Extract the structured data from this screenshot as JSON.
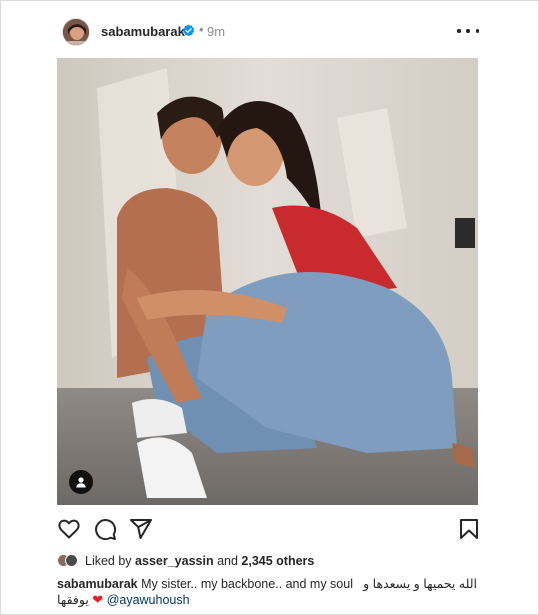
{
  "post": {
    "username": "sabamubarak",
    "time_separator": "•",
    "time": "9m",
    "liked_by_prefix": "Liked by",
    "liked_by_user": "asser_yassin",
    "liked_by_middle": "and",
    "liked_by_others": "2,345 others",
    "caption_user": "sabamubarak",
    "caption_text": "My sister.. my backbone.. and my soul",
    "caption_arabic_1": "الله يحميها و يسعدها و",
    "caption_arabic_2": "يوفقها",
    "caption_heart": "❤",
    "caption_mention": "@ayawuhoush"
  },
  "icons": {
    "avatar": "profile-avatar",
    "verified": "verified-badge-icon",
    "more": "more-options-icon",
    "tag": "user-tag-icon",
    "like": "heart-icon",
    "comment": "comment-icon",
    "share": "share-icon",
    "save": "bookmark-icon"
  },
  "colors": {
    "verified": "#0095f6",
    "text": "#262626",
    "muted": "#8e8e8e",
    "heart": "#ed1c24"
  }
}
